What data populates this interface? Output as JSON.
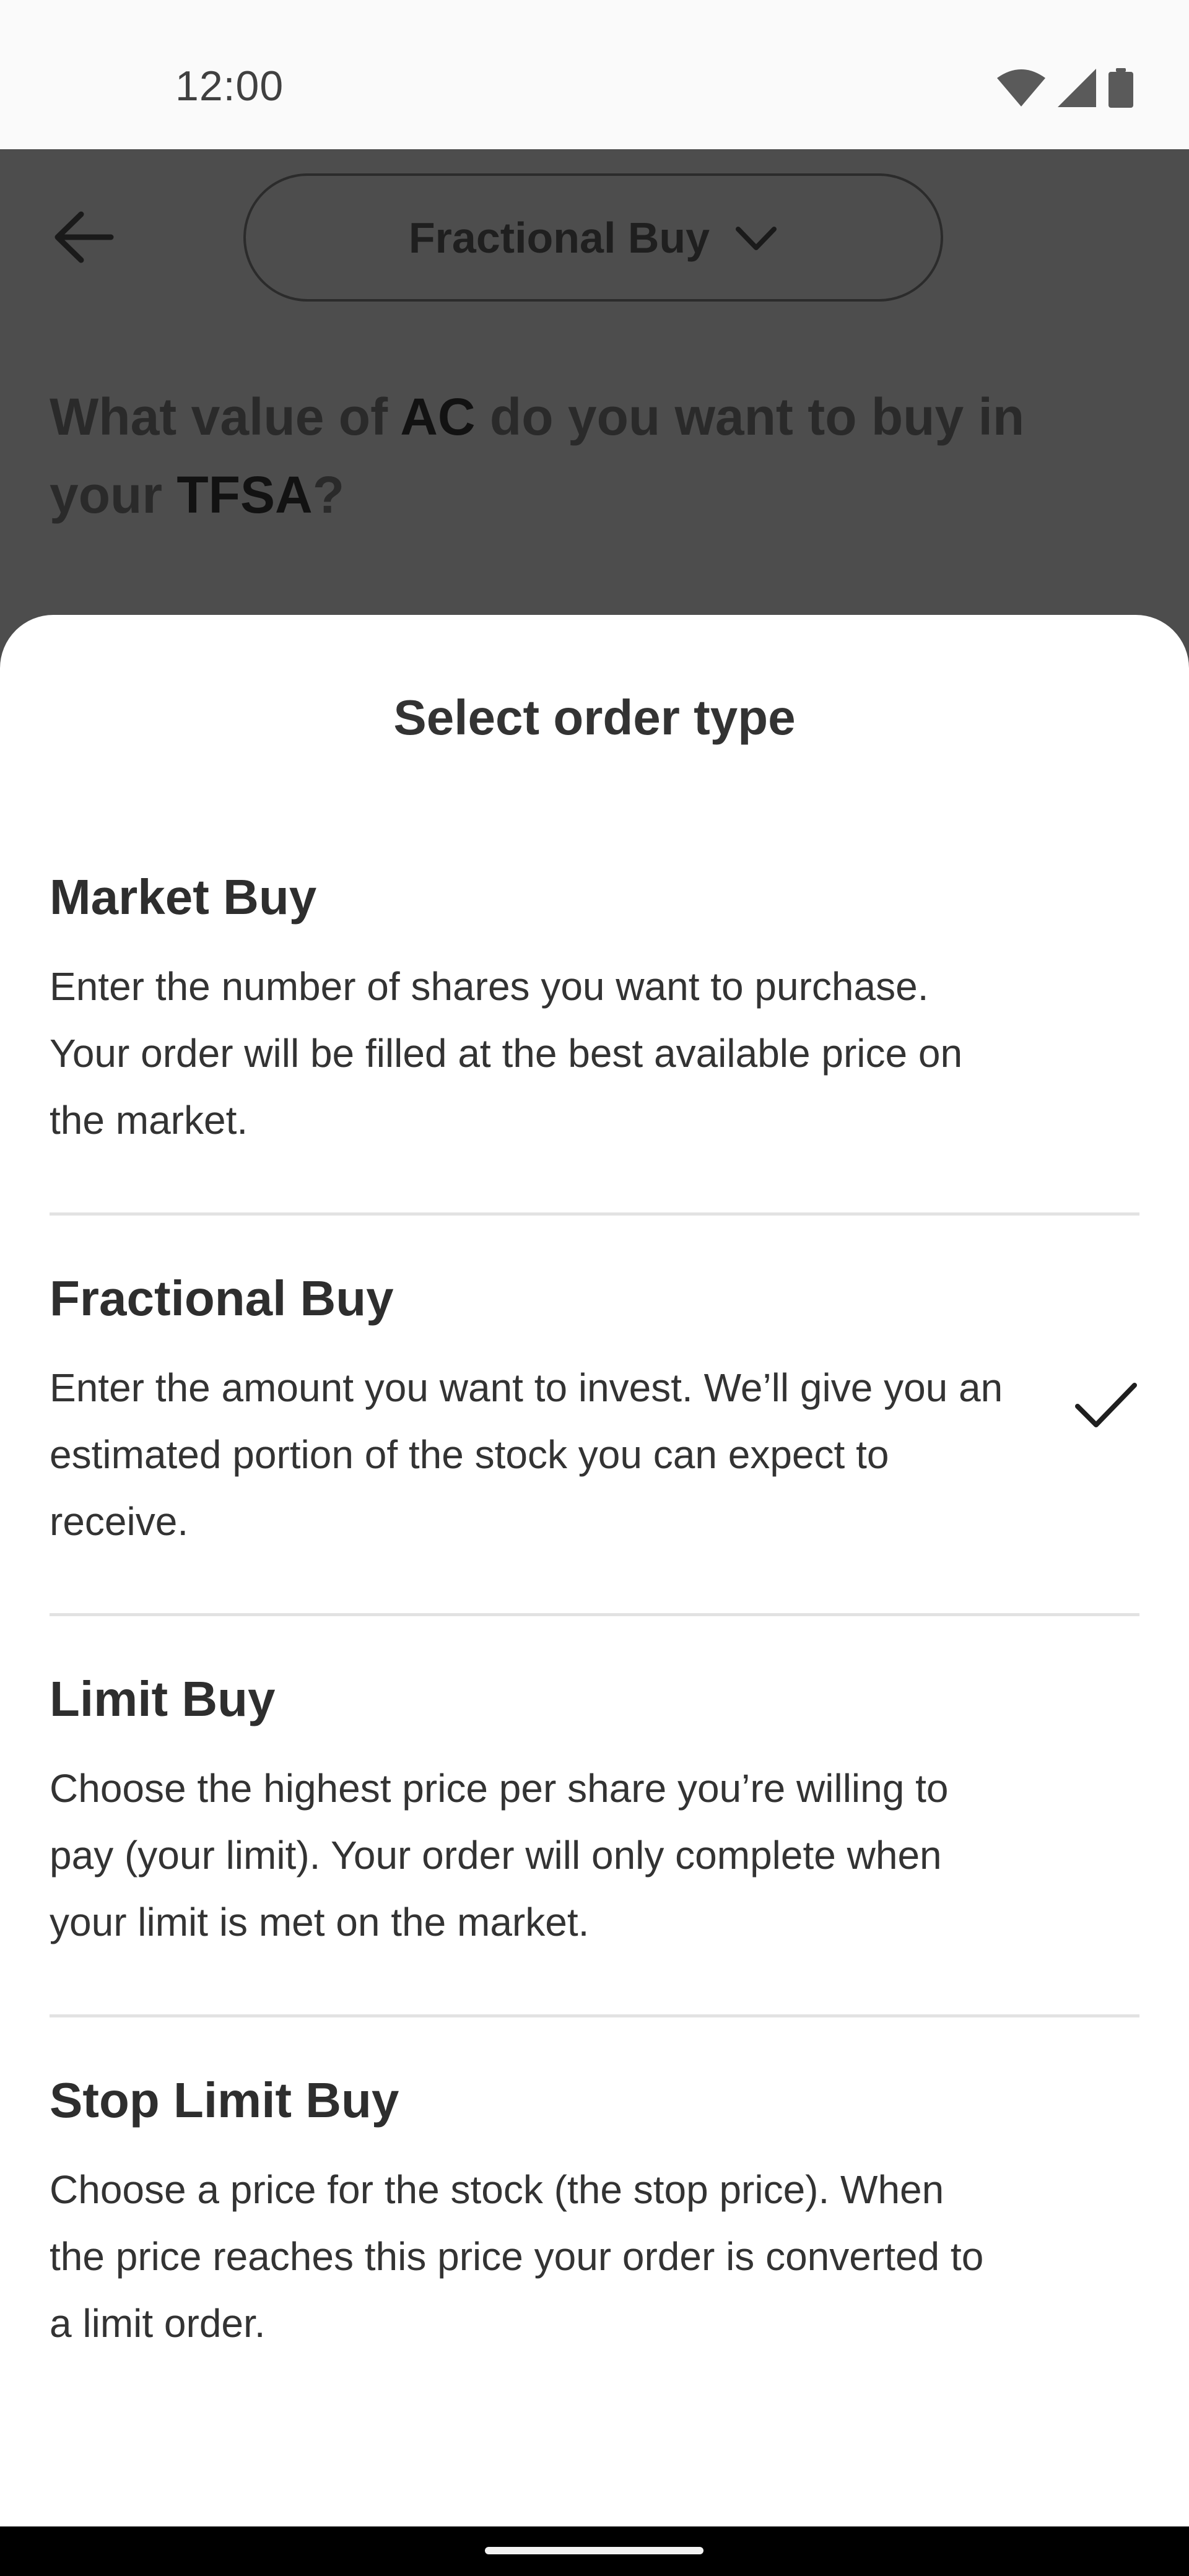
{
  "status_bar": {
    "time": "12:00",
    "icons": [
      "wifi-icon",
      "cellular-signal-icon",
      "battery-icon"
    ]
  },
  "background": {
    "back_icon": "arrow-left-icon",
    "order_type_selector": {
      "label": "Fractional Buy",
      "icon": "chevron-down-icon"
    },
    "question": {
      "prefix": "What value of ",
      "symbol": "AC",
      "middle": " do you want to buy in your ",
      "account": "TFSA",
      "suffix": "?"
    }
  },
  "sheet": {
    "title": "Select order type",
    "options": [
      {
        "title": "Market Buy",
        "description": "Enter the number of shares you want to purchase. Your order will be filled at the best available price on the market.",
        "selected": false
      },
      {
        "title": "Fractional Buy",
        "description": "Enter the amount you want to invest. We’ll give you an estimated portion of the stock you can expect to receive.",
        "selected": true,
        "icon": "checkmark-icon"
      },
      {
        "title": "Limit Buy",
        "description": "Choose the highest price per share you’re willing to pay (your limit). Your order will only complete when your limit is met on the market.",
        "selected": false
      },
      {
        "title": "Stop Limit Buy",
        "description": "Choose a price for the stock (the stop price). When the price reaches this price your order is converted to a limit order.",
        "selected": false
      }
    ]
  },
  "colors": {
    "scrim": "#4d4d4d",
    "sheet": "#ffffff",
    "text": "#333333",
    "divider": "#e2e2e2"
  }
}
